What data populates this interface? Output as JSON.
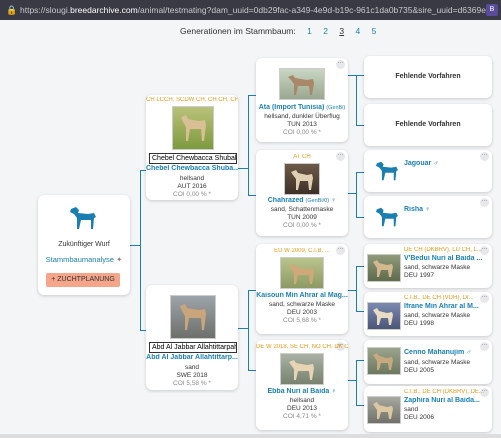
{
  "browser": {
    "url_prefix": "https://slougi.",
    "url_domain": "breedarchive.com",
    "url_rest": "/animal/testmating?dam_uuid=0db29fac-a349-4e9d-b19c-961c1da0b735&sire_uuid=d6369e73-c4b1",
    "ext_label": "B"
  },
  "generations": {
    "label": "Generationen im Stammbaum:",
    "options": [
      "1",
      "2",
      "3",
      "4",
      "5"
    ],
    "active": "3"
  },
  "root": {
    "label": "Zukünftiger Wurf",
    "analysis_link": "Stammbaumanalyse",
    "button": "+ ZUCHTPLANUNG"
  },
  "sire": {
    "titles": "CH LCCH, SCDW CH, CH CH, CH ...",
    "tooltip": "Chebel Chewbacca Shubah a",
    "name": "Chebel Chewbacca Shuba...",
    "color": "hellsand",
    "country_year": "AUT 2016",
    "coi": "COI 0,00 % *"
  },
  "dam": {
    "tooltip": "Abd Al Jabbar Allahtittarpahr",
    "name": "Abd Al Jabbar Allahtittarp...",
    "color": "sand",
    "country_year": "SWE 2018",
    "coi": "COI 5,58 % *"
  },
  "g2": [
    {
      "titles": "",
      "name": "Ata (Import Tunisia)",
      "reg": "(GenBi)",
      "color": "hellsand, dunkler Überflug",
      "country_year": "TUN 2013",
      "coi": "COI 0,00 % *"
    },
    {
      "titles": "AT CH",
      "name": "Chahrazed",
      "reg": "(GenBi/0)",
      "sex": "♀",
      "color": "sand, Schattenmaske",
      "country_year": "TUN 2009",
      "coi": "COI 0,00 % *"
    },
    {
      "titles": "EU W 2009, C.I.B, ...",
      "name": "Kaisoun Min Ahrar al Mag...",
      "color": "sand, schwarze Maske",
      "country_year": "DEU 2003",
      "coi": "COI 5,68 % *"
    },
    {
      "titles": "DE W 2018, SE CH, NO CH, DK CH ...",
      "name": "Ebba Nuri al Baida",
      "sex": "♀",
      "color": "hellsand",
      "country_year": "DEU 2013",
      "coi": "COI 4,71 % *"
    }
  ],
  "g3": [
    {
      "type": "missing",
      "label": "Fehlende Vorfahren"
    },
    {
      "type": "missing",
      "label": "Fehlende Vorfahren"
    },
    {
      "type": "dog",
      "name": "Jagouar",
      "sex": "♂"
    },
    {
      "type": "dog",
      "name": "Risha",
      "sex": "♀"
    },
    {
      "type": "photo",
      "titles": "DE CH (DKBRV), LU CH, L...",
      "name": "V'Bedui Nuri al Baida ...",
      "color": "sand, schwarze Maske",
      "country_year": "DEU 1997"
    },
    {
      "type": "photo",
      "titles": "C.I.B., DE CH (VDH), Dr...",
      "name": "Ifrane Min Ahrar al M...",
      "color": "sand, schwarze Maske",
      "country_year": "DEU 1998"
    },
    {
      "type": "photo",
      "titles": "",
      "name": "Cenno Mahanujim",
      "sex": "♂",
      "color": "sand, schwarze Maske",
      "country_year": "DEU 2005"
    },
    {
      "type": "photo",
      "titles": "C.I.B., DE CH (DKBRV), DE...",
      "name": "Zaphira Nuri al Baida...",
      "color": "sand",
      "country_year": "DEU 2006"
    }
  ],
  "colors": {
    "accent": "#1a7fb0",
    "titles": "#e09a17",
    "button": "#f4a58a"
  }
}
